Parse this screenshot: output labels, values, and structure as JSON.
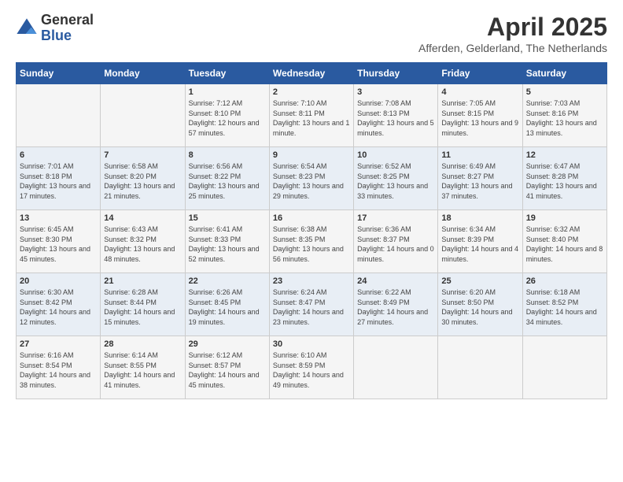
{
  "logo": {
    "general": "General",
    "blue": "Blue"
  },
  "title": "April 2025",
  "location": "Afferden, Gelderland, The Netherlands",
  "days_header": [
    "Sunday",
    "Monday",
    "Tuesday",
    "Wednesday",
    "Thursday",
    "Friday",
    "Saturday"
  ],
  "weeks": [
    [
      {
        "day": "",
        "info": ""
      },
      {
        "day": "",
        "info": ""
      },
      {
        "day": "1",
        "info": "Sunrise: 7:12 AM\nSunset: 8:10 PM\nDaylight: 12 hours and 57 minutes."
      },
      {
        "day": "2",
        "info": "Sunrise: 7:10 AM\nSunset: 8:11 PM\nDaylight: 13 hours and 1 minute."
      },
      {
        "day": "3",
        "info": "Sunrise: 7:08 AM\nSunset: 8:13 PM\nDaylight: 13 hours and 5 minutes."
      },
      {
        "day": "4",
        "info": "Sunrise: 7:05 AM\nSunset: 8:15 PM\nDaylight: 13 hours and 9 minutes."
      },
      {
        "day": "5",
        "info": "Sunrise: 7:03 AM\nSunset: 8:16 PM\nDaylight: 13 hours and 13 minutes."
      }
    ],
    [
      {
        "day": "6",
        "info": "Sunrise: 7:01 AM\nSunset: 8:18 PM\nDaylight: 13 hours and 17 minutes."
      },
      {
        "day": "7",
        "info": "Sunrise: 6:58 AM\nSunset: 8:20 PM\nDaylight: 13 hours and 21 minutes."
      },
      {
        "day": "8",
        "info": "Sunrise: 6:56 AM\nSunset: 8:22 PM\nDaylight: 13 hours and 25 minutes."
      },
      {
        "day": "9",
        "info": "Sunrise: 6:54 AM\nSunset: 8:23 PM\nDaylight: 13 hours and 29 minutes."
      },
      {
        "day": "10",
        "info": "Sunrise: 6:52 AM\nSunset: 8:25 PM\nDaylight: 13 hours and 33 minutes."
      },
      {
        "day": "11",
        "info": "Sunrise: 6:49 AM\nSunset: 8:27 PM\nDaylight: 13 hours and 37 minutes."
      },
      {
        "day": "12",
        "info": "Sunrise: 6:47 AM\nSunset: 8:28 PM\nDaylight: 13 hours and 41 minutes."
      }
    ],
    [
      {
        "day": "13",
        "info": "Sunrise: 6:45 AM\nSunset: 8:30 PM\nDaylight: 13 hours and 45 minutes."
      },
      {
        "day": "14",
        "info": "Sunrise: 6:43 AM\nSunset: 8:32 PM\nDaylight: 13 hours and 48 minutes."
      },
      {
        "day": "15",
        "info": "Sunrise: 6:41 AM\nSunset: 8:33 PM\nDaylight: 13 hours and 52 minutes."
      },
      {
        "day": "16",
        "info": "Sunrise: 6:38 AM\nSunset: 8:35 PM\nDaylight: 13 hours and 56 minutes."
      },
      {
        "day": "17",
        "info": "Sunrise: 6:36 AM\nSunset: 8:37 PM\nDaylight: 14 hours and 0 minutes."
      },
      {
        "day": "18",
        "info": "Sunrise: 6:34 AM\nSunset: 8:39 PM\nDaylight: 14 hours and 4 minutes."
      },
      {
        "day": "19",
        "info": "Sunrise: 6:32 AM\nSunset: 8:40 PM\nDaylight: 14 hours and 8 minutes."
      }
    ],
    [
      {
        "day": "20",
        "info": "Sunrise: 6:30 AM\nSunset: 8:42 PM\nDaylight: 14 hours and 12 minutes."
      },
      {
        "day": "21",
        "info": "Sunrise: 6:28 AM\nSunset: 8:44 PM\nDaylight: 14 hours and 15 minutes."
      },
      {
        "day": "22",
        "info": "Sunrise: 6:26 AM\nSunset: 8:45 PM\nDaylight: 14 hours and 19 minutes."
      },
      {
        "day": "23",
        "info": "Sunrise: 6:24 AM\nSunset: 8:47 PM\nDaylight: 14 hours and 23 minutes."
      },
      {
        "day": "24",
        "info": "Sunrise: 6:22 AM\nSunset: 8:49 PM\nDaylight: 14 hours and 27 minutes."
      },
      {
        "day": "25",
        "info": "Sunrise: 6:20 AM\nSunset: 8:50 PM\nDaylight: 14 hours and 30 minutes."
      },
      {
        "day": "26",
        "info": "Sunrise: 6:18 AM\nSunset: 8:52 PM\nDaylight: 14 hours and 34 minutes."
      }
    ],
    [
      {
        "day": "27",
        "info": "Sunrise: 6:16 AM\nSunset: 8:54 PM\nDaylight: 14 hours and 38 minutes."
      },
      {
        "day": "28",
        "info": "Sunrise: 6:14 AM\nSunset: 8:55 PM\nDaylight: 14 hours and 41 minutes."
      },
      {
        "day": "29",
        "info": "Sunrise: 6:12 AM\nSunset: 8:57 PM\nDaylight: 14 hours and 45 minutes."
      },
      {
        "day": "30",
        "info": "Sunrise: 6:10 AM\nSunset: 8:59 PM\nDaylight: 14 hours and 49 minutes."
      },
      {
        "day": "",
        "info": ""
      },
      {
        "day": "",
        "info": ""
      },
      {
        "day": "",
        "info": ""
      }
    ]
  ]
}
